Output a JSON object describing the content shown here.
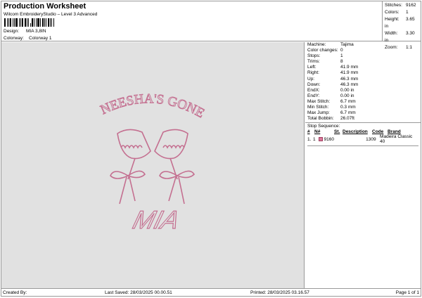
{
  "header": {
    "title": "Production Worksheet",
    "subtitle": "Wilcom EmbroideryStudio – Level 3 Advanced",
    "design_label": "Design:",
    "design_value": "MIA 3,8IN",
    "colorway_label": "Colorway:",
    "colorway_value": "Colorway 1"
  },
  "stats": [
    {
      "k": "Stitches:",
      "v": "9162"
    },
    {
      "k": "Colors:",
      "v": "1"
    },
    {
      "k": "Height:",
      "v": "3.65 in"
    },
    {
      "k": "Width:",
      "v": "3.30 in"
    },
    {
      "k": "Zoom:",
      "v": "1:1"
    }
  ],
  "design": {
    "arc_text": "NEESHA'S GONE",
    "name_text": "MIA",
    "thread_color": "#d17a9c"
  },
  "properties": [
    {
      "k": "Machine:",
      "v": "Tajima"
    },
    {
      "k": "Color changes:",
      "v": "0"
    },
    {
      "k": "Stops:",
      "v": "1"
    },
    {
      "k": "Trims:",
      "v": "8"
    },
    {
      "k": "Left:",
      "v": "41.9 mm"
    },
    {
      "k": "Right:",
      "v": "41.9 mm"
    },
    {
      "k": "Up:",
      "v": "46.3 mm"
    },
    {
      "k": "Down:",
      "v": "46.3 mm"
    },
    {
      "k": "EndX:",
      "v": "0.00 in"
    },
    {
      "k": "EndY:",
      "v": "0.00 in"
    },
    {
      "k": "Max Stitch:",
      "v": "6.7 mm"
    },
    {
      "k": "Min Stitch:",
      "v": "0.3 mm"
    },
    {
      "k": "Max Jump:",
      "v": "6.7 mm"
    },
    {
      "k": "Total Bobbin:",
      "v": "26.07ft"
    }
  ],
  "stop_sequence": {
    "title": "Stop Sequence:",
    "headers": [
      "#",
      "N#",
      "St.",
      "Description",
      "Code",
      "Brand"
    ],
    "rows": [
      {
        "num": "1.",
        "n": "1",
        "color": "#d9779a",
        "st": "9160",
        "code": "1309",
        "brand": "Madeira Classic 40"
      }
    ]
  },
  "footer": {
    "created": "Created By:",
    "saved": "Last Saved: 28/03/2025 00.00.51",
    "printed": "Printed: 28/03/2025 03.16.57",
    "page": "Page 1 of 1"
  }
}
